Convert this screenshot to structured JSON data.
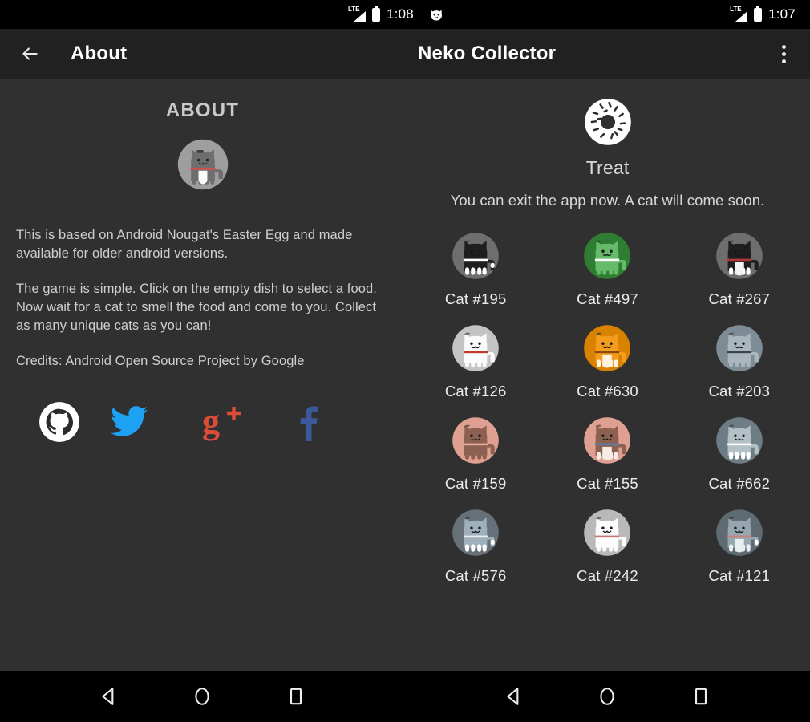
{
  "status_bar": {
    "left": {
      "network": "LTE",
      "time": "1:08",
      "notification_icon": "cat-face-icon"
    },
    "right": {
      "network": "LTE",
      "time": "1:07"
    }
  },
  "toolbar": {
    "back_icon": "arrow-left-icon",
    "left_title": "About",
    "right_title": "Neko Collector",
    "overflow_icon": "more-vertical-icon"
  },
  "about": {
    "heading": "ABOUT",
    "avatar_icon": "cat-avatar-icon",
    "paragraphs": [
      "This is based on Android Nougat's Easter Egg and made available for older android versions.",
      "The game is simple. Click on the empty dish to select a food. Now wait for a cat to smell the food and come to you. Collect as many unique cats as you can!",
      "Credits: Android Open Source Project by Google"
    ],
    "socials": [
      {
        "name": "github",
        "label": "GitHub",
        "color": "#ffffff"
      },
      {
        "name": "twitter",
        "label": "Twitter",
        "color": "#1da1f2"
      },
      {
        "name": "googleplus",
        "label": "Google Plus",
        "color": "#dd4b39"
      },
      {
        "name": "facebook",
        "label": "Facebook",
        "color": "#3b5998"
      }
    ]
  },
  "treat": {
    "icon": "donut-icon",
    "label": "Treat",
    "message": "You can exit the app now. A cat will come soon."
  },
  "cats": [
    {
      "name": "Cat #195",
      "bg": "#6e6e6e",
      "body": "#1f1f1f",
      "collar": "#ffffff",
      "belly": "none",
      "tail_tip": "#ffffff",
      "feet": "#ffffff"
    },
    {
      "name": "Cat #497",
      "bg": "#2e7d32",
      "body": "#66bb6a",
      "collar": "#ffffff",
      "belly": "none",
      "tail_tip": "#66bb6a",
      "feet": "#66bb6a"
    },
    {
      "name": "Cat #267",
      "bg": "#6e6e6e",
      "body": "#1f1f1f",
      "collar": "#b03a3a",
      "belly": "#f2f2f2",
      "tail_tip": "#1f1f1f",
      "feet": "#ffffff"
    },
    {
      "name": "Cat #126",
      "bg": "#c4c4c4",
      "body": "#fafafa",
      "collar": "#c0392b",
      "belly": "none",
      "tail_tip": "#fafafa",
      "feet": "#fafafa"
    },
    {
      "name": "Cat #630",
      "bg": "#d98200",
      "body": "#f59b1e",
      "collar": "#8a4b10",
      "belly": "#fdf3df",
      "tail_tip": "#f59b1e",
      "feet": "#fdf3df"
    },
    {
      "name": "Cat #203",
      "bg": "#7e8c95",
      "body": "#a9b6bd",
      "collar": "#3c4347",
      "belly": "none",
      "tail_tip": "#a9b6bd",
      "feet": "#a9b6bd"
    },
    {
      "name": "Cat #159",
      "bg": "#dfa091",
      "body": "#8d6151",
      "collar": "#e8a9a0",
      "belly": "none",
      "tail_tip": "#8d6151",
      "feet": "#8d6151"
    },
    {
      "name": "Cat #155",
      "bg": "#dfa091",
      "body": "#8d6151",
      "collar": "#5b7fa8",
      "belly": "#f6ece6",
      "tail_tip": "#8d6151",
      "feet": "#f6ece6"
    },
    {
      "name": "Cat #662",
      "bg": "#6d7c85",
      "body": "#b3c0c6",
      "collar": "#ffffff",
      "belly": "none",
      "tail_tip": "#b3c0c6",
      "feet": "#ffffff"
    },
    {
      "name": "Cat #576",
      "bg": "#657079",
      "body": "#9fb0ba",
      "collar": "#e8eef1",
      "belly": "none",
      "tail_tip": "#ffffff",
      "feet": "#ffffff"
    },
    {
      "name": "Cat #242",
      "bg": "#b9b9b9",
      "body": "#fbfbfb",
      "collar": "#c9766e",
      "belly": "none",
      "tail_tip": "#fbfbfb",
      "feet": "#fbfbfb"
    },
    {
      "name": "Cat #121",
      "bg": "#5f6b73",
      "body": "#97a7b0",
      "collar": "#cf7d76",
      "belly": "#e9eef1",
      "tail_tip": "#ffffff",
      "feet": "#e9eef1"
    }
  ],
  "navbar": {
    "buttons": [
      {
        "name": "back",
        "icon": "triangle-left-icon"
      },
      {
        "name": "home",
        "icon": "circle-icon"
      },
      {
        "name": "recents",
        "icon": "square-icon"
      }
    ]
  },
  "theme": {
    "status_bar_bg": "#000000",
    "toolbar_bg": "#212121",
    "content_bg": "#303030",
    "nav_bg": "#000000",
    "text_primary": "#ffffff",
    "text_secondary": "#cfcfcf"
  }
}
